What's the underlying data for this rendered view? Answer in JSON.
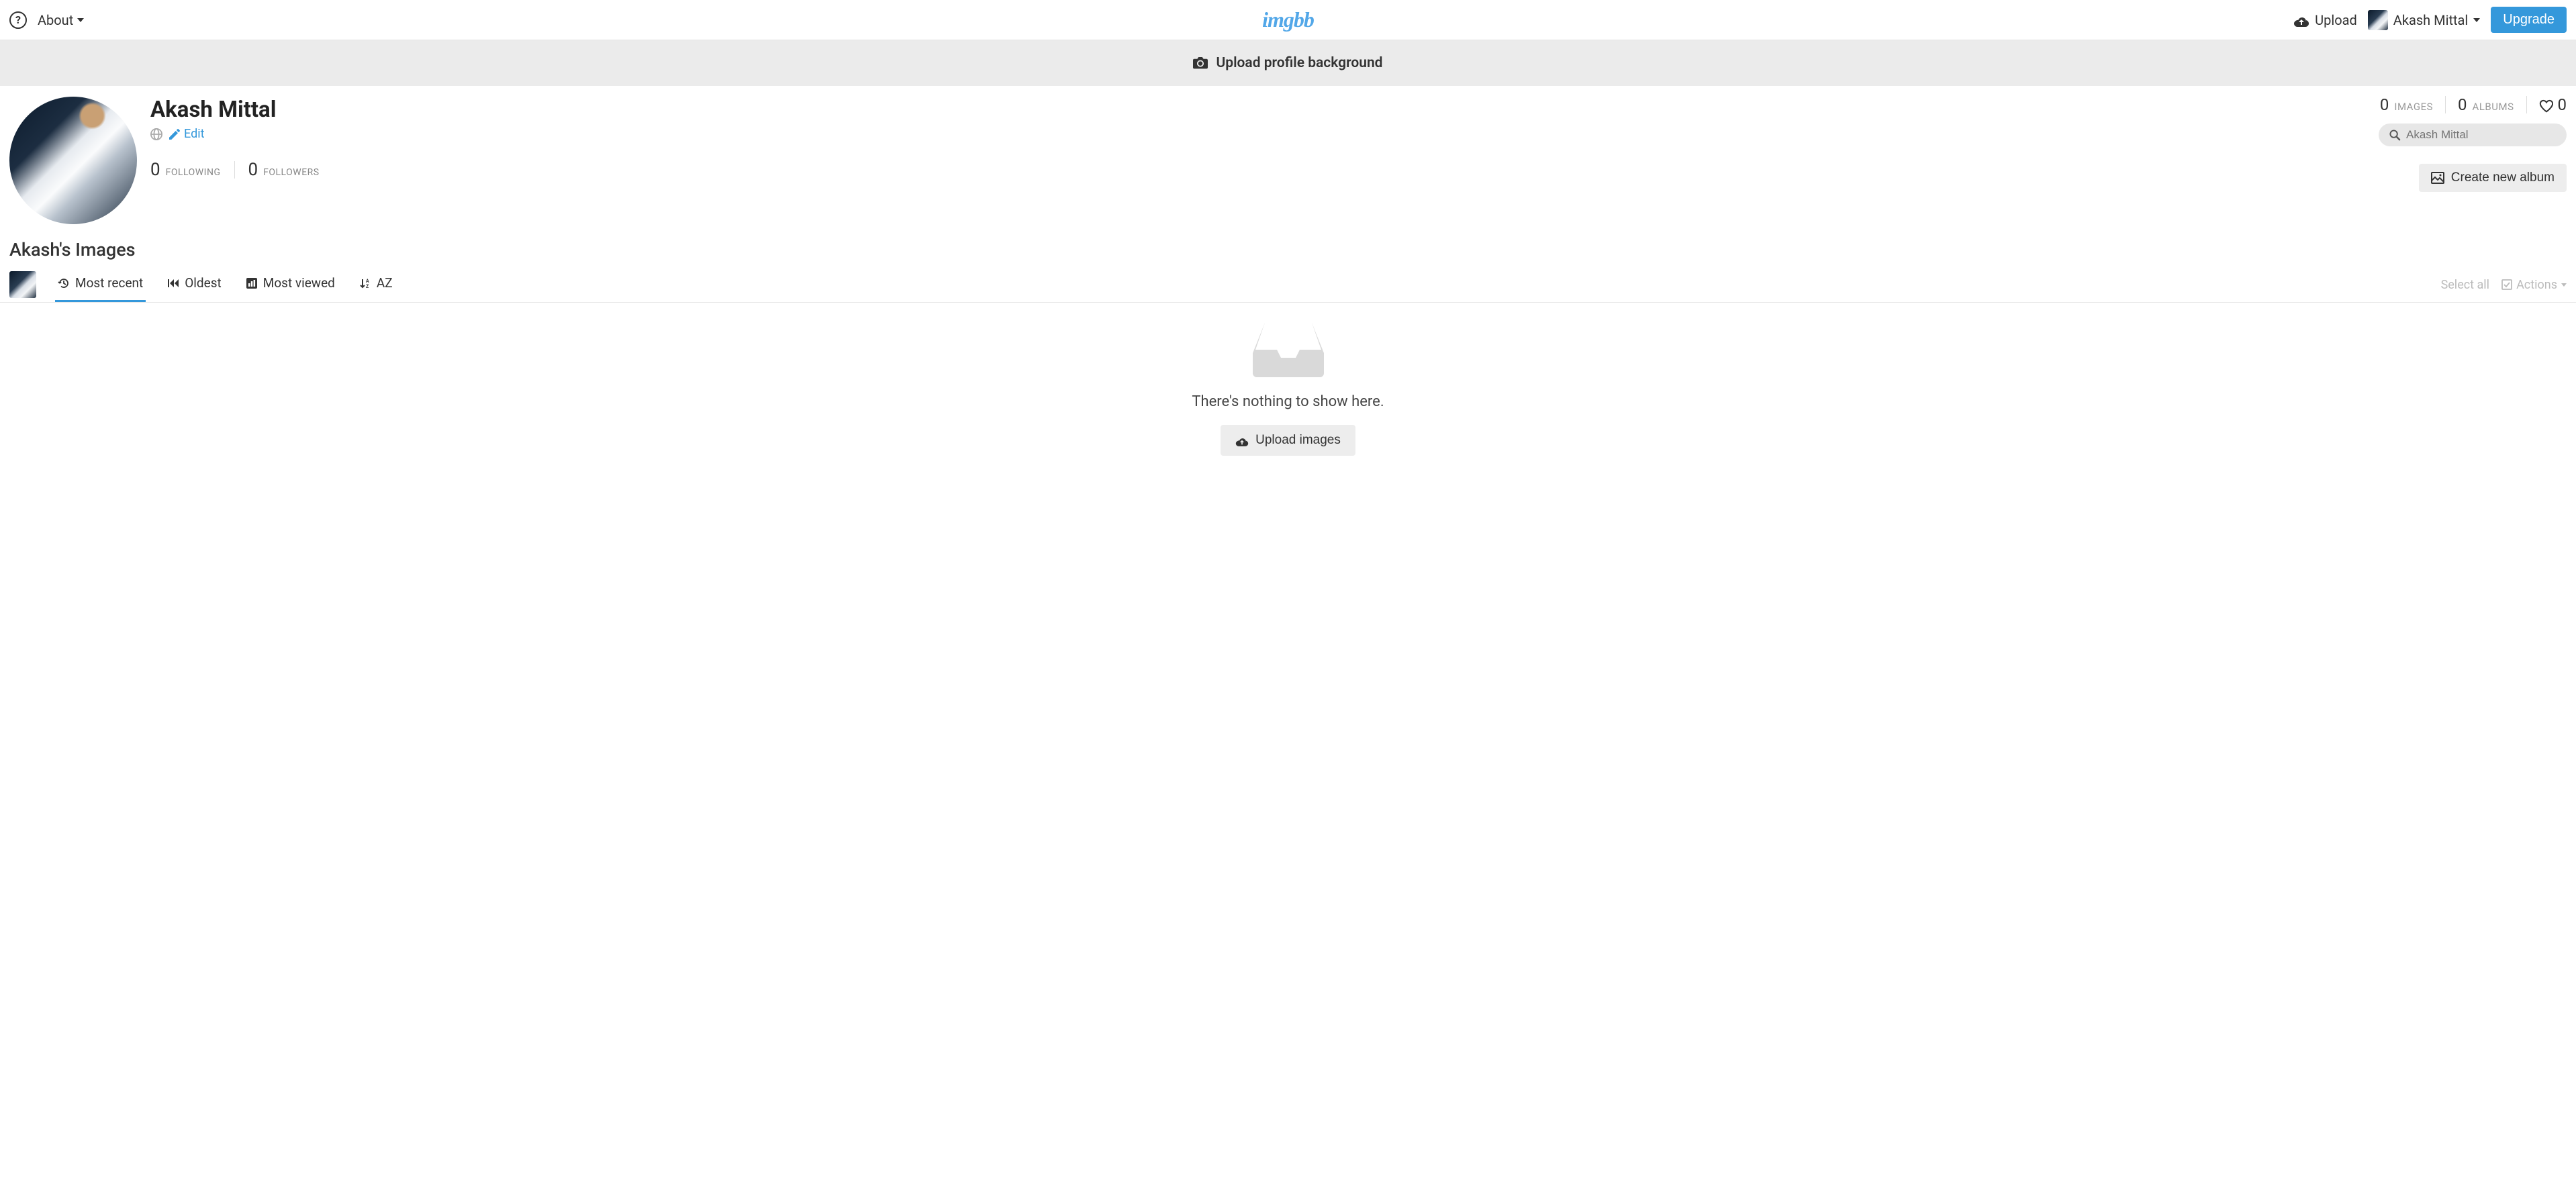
{
  "topbar": {
    "about_label": "About",
    "logo_text": "imgbb",
    "upload_label": "Upload",
    "user_name": "Akash Mittal",
    "upgrade_label": "Upgrade"
  },
  "banner": {
    "upload_bg_label": "Upload profile background"
  },
  "profile": {
    "display_name": "Akash Mittal",
    "edit_label": "Edit",
    "following_count": "0",
    "following_label": "FOLLOWING",
    "followers_count": "0",
    "followers_label": "FOLLOWERS"
  },
  "stats": {
    "images_count": "0",
    "images_label": "IMAGES",
    "albums_count": "0",
    "albums_label": "ALBUMS",
    "likes_count": "0"
  },
  "search": {
    "placeholder": "Akash Mittal"
  },
  "buttons": {
    "create_album_label": "Create new album",
    "upload_images_label": "Upload images"
  },
  "section": {
    "title": "Akash's Images"
  },
  "tabs": {
    "most_recent": "Most recent",
    "oldest": "Oldest",
    "most_viewed": "Most viewed",
    "az": "AZ",
    "select_all": "Select all",
    "actions": "Actions"
  },
  "empty": {
    "message": "There's nothing to show here."
  }
}
